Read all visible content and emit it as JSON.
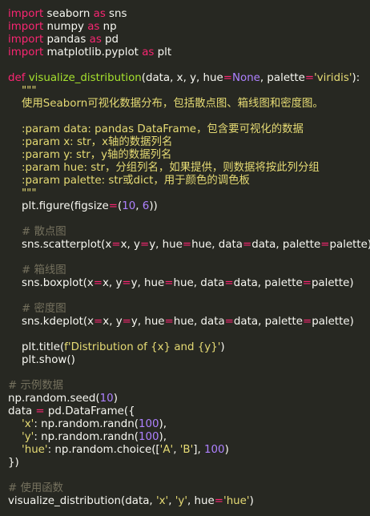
{
  "code": {
    "lines": [
      [
        {
          "t": "import",
          "c": "kw"
        },
        {
          "t": " seaborn ",
          "c": "pl"
        },
        {
          "t": "as",
          "c": "kw"
        },
        {
          "t": " sns",
          "c": "pl"
        }
      ],
      [
        {
          "t": "import",
          "c": "kw"
        },
        {
          "t": " numpy ",
          "c": "pl"
        },
        {
          "t": "as",
          "c": "kw"
        },
        {
          "t": " np",
          "c": "pl"
        }
      ],
      [
        {
          "t": "import",
          "c": "kw"
        },
        {
          "t": " pandas ",
          "c": "pl"
        },
        {
          "t": "as",
          "c": "kw"
        },
        {
          "t": " pd",
          "c": "pl"
        }
      ],
      [
        {
          "t": "import",
          "c": "kw"
        },
        {
          "t": " matplotlib.pyplot ",
          "c": "pl"
        },
        {
          "t": "as",
          "c": "kw"
        },
        {
          "t": " plt",
          "c": "pl"
        }
      ],
      [],
      [
        {
          "t": "def",
          "c": "kw"
        },
        {
          "t": " ",
          "c": "pl"
        },
        {
          "t": "visualize_distribution",
          "c": "fn"
        },
        {
          "t": "(data, x, y, hue",
          "c": "pl"
        },
        {
          "t": "=",
          "c": "op"
        },
        {
          "t": "None",
          "c": "bool"
        },
        {
          "t": ", palette",
          "c": "pl"
        },
        {
          "t": "=",
          "c": "op"
        },
        {
          "t": "'viridis'",
          "c": "str"
        },
        {
          "t": "):",
          "c": "pl"
        }
      ],
      [
        {
          "t": "    \"\"\"",
          "c": "str"
        }
      ],
      [
        {
          "t": "    使用Seaborn可视化数据分布，包括散点图、箱线图和密度图。",
          "c": "str"
        }
      ],
      [],
      [
        {
          "t": "    :param data: pandas DataFrame，包含要可视化的数据",
          "c": "str"
        }
      ],
      [
        {
          "t": "    :param x: str，x轴的数据列名",
          "c": "str"
        }
      ],
      [
        {
          "t": "    :param y: str，y轴的数据列名",
          "c": "str"
        }
      ],
      [
        {
          "t": "    :param hue: str，分组列名，如果提供，则数据将按此列分组",
          "c": "str"
        }
      ],
      [
        {
          "t": "    :param palette: str或dict，用于颜色的调色板",
          "c": "str"
        }
      ],
      [
        {
          "t": "    \"\"\"",
          "c": "str"
        }
      ],
      [
        {
          "t": "    plt",
          "c": "pl"
        },
        {
          "t": ".",
          "c": "dot"
        },
        {
          "t": "figure(figsize",
          "c": "pl"
        },
        {
          "t": "=",
          "c": "op"
        },
        {
          "t": "(",
          "c": "pl"
        },
        {
          "t": "10",
          "c": "num"
        },
        {
          "t": ", ",
          "c": "pl"
        },
        {
          "t": "6",
          "c": "num"
        },
        {
          "t": "))",
          "c": "pl"
        }
      ],
      [],
      [
        {
          "t": "    # 散点图",
          "c": "cm"
        }
      ],
      [
        {
          "t": "    sns",
          "c": "pl"
        },
        {
          "t": ".",
          "c": "dot"
        },
        {
          "t": "scatterplot(x",
          "c": "pl"
        },
        {
          "t": "=",
          "c": "op"
        },
        {
          "t": "x, y",
          "c": "pl"
        },
        {
          "t": "=",
          "c": "op"
        },
        {
          "t": "y, hue",
          "c": "pl"
        },
        {
          "t": "=",
          "c": "op"
        },
        {
          "t": "hue, data",
          "c": "pl"
        },
        {
          "t": "=",
          "c": "op"
        },
        {
          "t": "data, palette",
          "c": "pl"
        },
        {
          "t": "=",
          "c": "op"
        },
        {
          "t": "palette)",
          "c": "pl"
        }
      ],
      [],
      [
        {
          "t": "    # 箱线图",
          "c": "cm"
        }
      ],
      [
        {
          "t": "    sns",
          "c": "pl"
        },
        {
          "t": ".",
          "c": "dot"
        },
        {
          "t": "boxplot(x",
          "c": "pl"
        },
        {
          "t": "=",
          "c": "op"
        },
        {
          "t": "x, y",
          "c": "pl"
        },
        {
          "t": "=",
          "c": "op"
        },
        {
          "t": "y, hue",
          "c": "pl"
        },
        {
          "t": "=",
          "c": "op"
        },
        {
          "t": "hue, data",
          "c": "pl"
        },
        {
          "t": "=",
          "c": "op"
        },
        {
          "t": "data, palette",
          "c": "pl"
        },
        {
          "t": "=",
          "c": "op"
        },
        {
          "t": "palette)",
          "c": "pl"
        }
      ],
      [],
      [
        {
          "t": "    # 密度图",
          "c": "cm"
        }
      ],
      [
        {
          "t": "    sns",
          "c": "pl"
        },
        {
          "t": ".",
          "c": "dot"
        },
        {
          "t": "kdeplot(x",
          "c": "pl"
        },
        {
          "t": "=",
          "c": "op"
        },
        {
          "t": "x, y",
          "c": "pl"
        },
        {
          "t": "=",
          "c": "op"
        },
        {
          "t": "y, hue",
          "c": "pl"
        },
        {
          "t": "=",
          "c": "op"
        },
        {
          "t": "hue, data",
          "c": "pl"
        },
        {
          "t": "=",
          "c": "op"
        },
        {
          "t": "data, palette",
          "c": "pl"
        },
        {
          "t": "=",
          "c": "op"
        },
        {
          "t": "palette)",
          "c": "pl"
        }
      ],
      [],
      [
        {
          "t": "    plt",
          "c": "pl"
        },
        {
          "t": ".",
          "c": "dot"
        },
        {
          "t": "title(",
          "c": "pl"
        },
        {
          "t": "f'Distribution of {x} and {y}'",
          "c": "str"
        },
        {
          "t": ")",
          "c": "pl"
        }
      ],
      [
        {
          "t": "    plt",
          "c": "pl"
        },
        {
          "t": ".",
          "c": "dot"
        },
        {
          "t": "show()",
          "c": "pl"
        }
      ],
      [],
      [
        {
          "t": "# 示例数据",
          "c": "cm"
        }
      ],
      [
        {
          "t": "np",
          "c": "pl"
        },
        {
          "t": ".",
          "c": "dot"
        },
        {
          "t": "random",
          "c": "pl"
        },
        {
          "t": ".",
          "c": "dot"
        },
        {
          "t": "seed(",
          "c": "pl"
        },
        {
          "t": "10",
          "c": "num"
        },
        {
          "t": ")",
          "c": "pl"
        }
      ],
      [
        {
          "t": "data ",
          "c": "pl"
        },
        {
          "t": "=",
          "c": "op"
        },
        {
          "t": " pd",
          "c": "pl"
        },
        {
          "t": ".",
          "c": "dot"
        },
        {
          "t": "DataFrame({",
          "c": "pl"
        }
      ],
      [
        {
          "t": "    'x'",
          "c": "str"
        },
        {
          "t": ": np",
          "c": "pl"
        },
        {
          "t": ".",
          "c": "dot"
        },
        {
          "t": "random",
          "c": "pl"
        },
        {
          "t": ".",
          "c": "dot"
        },
        {
          "t": "randn(",
          "c": "pl"
        },
        {
          "t": "100",
          "c": "num"
        },
        {
          "t": "),",
          "c": "pl"
        }
      ],
      [
        {
          "t": "    'y'",
          "c": "str"
        },
        {
          "t": ": np",
          "c": "pl"
        },
        {
          "t": ".",
          "c": "dot"
        },
        {
          "t": "random",
          "c": "pl"
        },
        {
          "t": ".",
          "c": "dot"
        },
        {
          "t": "randn(",
          "c": "pl"
        },
        {
          "t": "100",
          "c": "num"
        },
        {
          "t": "),",
          "c": "pl"
        }
      ],
      [
        {
          "t": "    'hue'",
          "c": "str"
        },
        {
          "t": ": np",
          "c": "pl"
        },
        {
          "t": ".",
          "c": "dot"
        },
        {
          "t": "random",
          "c": "pl"
        },
        {
          "t": ".",
          "c": "dot"
        },
        {
          "t": "choice([",
          "c": "pl"
        },
        {
          "t": "'A'",
          "c": "str"
        },
        {
          "t": ", ",
          "c": "pl"
        },
        {
          "t": "'B'",
          "c": "str"
        },
        {
          "t": "], ",
          "c": "pl"
        },
        {
          "t": "100",
          "c": "num"
        },
        {
          "t": ")",
          "c": "pl"
        }
      ],
      [
        {
          "t": "})",
          "c": "pl"
        }
      ],
      [],
      [
        {
          "t": "# 使用函数",
          "c": "cm"
        }
      ],
      [
        {
          "t": "visualize_distribution(data, ",
          "c": "pl"
        },
        {
          "t": "'x'",
          "c": "str"
        },
        {
          "t": ", ",
          "c": "pl"
        },
        {
          "t": "'y'",
          "c": "str"
        },
        {
          "t": ", hue",
          "c": "pl"
        },
        {
          "t": "=",
          "c": "op"
        },
        {
          "t": "'hue'",
          "c": "str"
        },
        {
          "t": ")",
          "c": "pl"
        }
      ]
    ]
  },
  "colors": {
    "background": "#272822",
    "keyword": "#f92672",
    "function": "#a6e22e",
    "string": "#e6db74",
    "number": "#ae81ff",
    "comment": "#75715e",
    "text": "#f8f8f2"
  }
}
